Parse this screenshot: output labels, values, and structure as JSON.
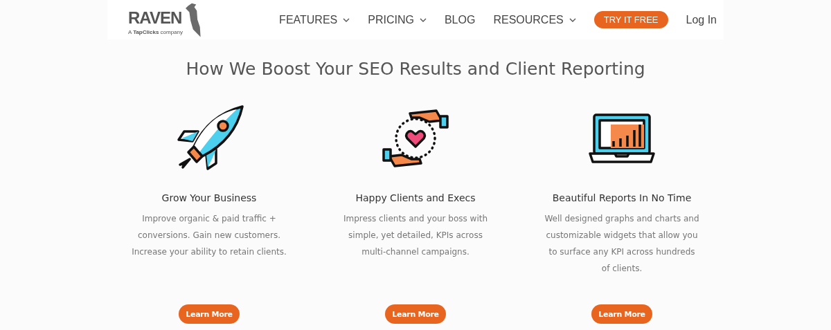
{
  "logo": {
    "wordmark": "RAVEN",
    "tagline": "A **TapClicks** company"
  },
  "nav": [
    {
      "label": "FEATURES",
      "has_dropdown": true
    },
    {
      "label": "PRICING",
      "has_dropdown": true
    },
    {
      "label": "BLOG",
      "has_dropdown": false
    },
    {
      "label": "RESOURCES",
      "has_dropdown": true
    }
  ],
  "cta": "TRY IT FREE",
  "login": "Log In",
  "heading": "How We Boost Your SEO Results and Client Reporting",
  "features": [
    {
      "kind": "rocket",
      "title": "Grow Your Business",
      "text": "Improve organic & paid traffic + conversions. Gain new customers. Increase your ability to retain clients.",
      "button": "Learn More"
    },
    {
      "kind": "hands",
      "title": "Happy Clients and Execs",
      "text": "Impress clients and your boss with simple, yet detailed, KPIs across multi-channel campaigns.",
      "button": "Learn More"
    },
    {
      "kind": "laptop",
      "title": "Beautiful Reports In No Time",
      "text": "Well designed graphs and charts and customizable widgets that allow you to surface any KPI across hundreds of clients.",
      "button": "Learn More"
    }
  ]
}
